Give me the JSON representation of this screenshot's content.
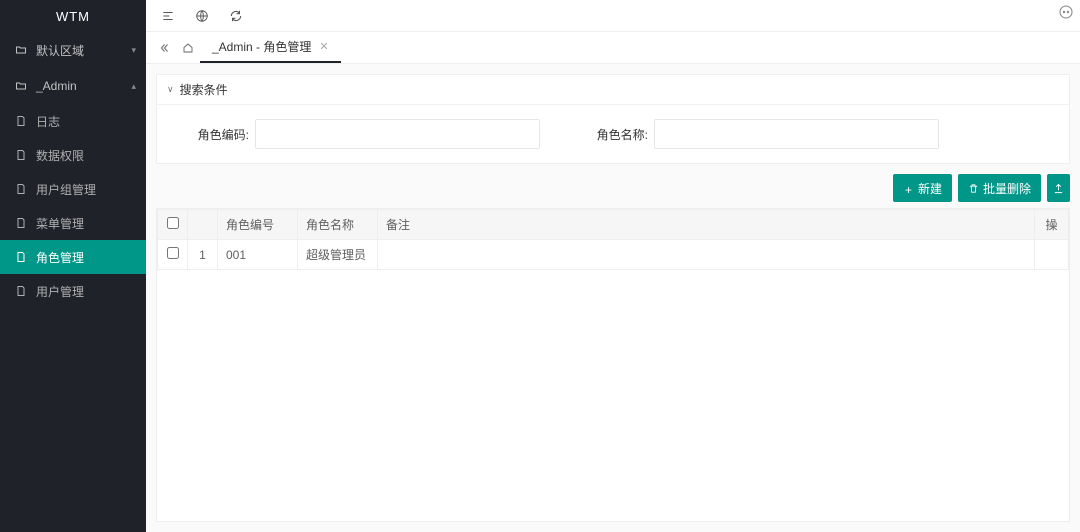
{
  "app": {
    "name": "WTM"
  },
  "sidebar": {
    "groups": [
      {
        "label": "默认区域",
        "expanded": false
      },
      {
        "label": "_Admin",
        "expanded": true
      }
    ],
    "admin_items": [
      {
        "label": "日志"
      },
      {
        "label": "数据权限"
      },
      {
        "label": "用户组管理"
      },
      {
        "label": "菜单管理"
      },
      {
        "label": "角色管理"
      },
      {
        "label": "用户管理"
      }
    ]
  },
  "tabs": {
    "active": {
      "label": "_Admin - 角色管理"
    }
  },
  "search": {
    "title": "搜索条件",
    "role_code_label": "角色编码:",
    "role_name_label": "角色名称:"
  },
  "buttons": {
    "create": "新建",
    "batch_delete": "批量删除"
  },
  "table": {
    "columns": {
      "code": "角色编号",
      "name": "角色名称",
      "remark": "备注",
      "ops": "操"
    },
    "rows": [
      {
        "index": "1",
        "code": "001",
        "name": "超级管理员",
        "remark": ""
      }
    ]
  }
}
